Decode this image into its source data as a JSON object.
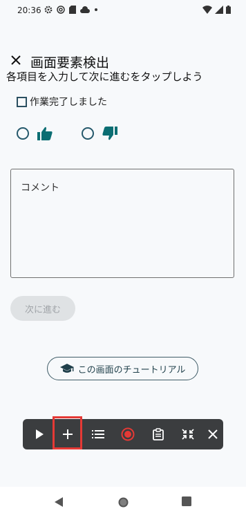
{
  "status_bar": {
    "time": "20:36",
    "left_icons": [
      "gear-icon",
      "at-icon",
      "sd-card-icon",
      "cloud-icon",
      "dot-icon"
    ],
    "right_icons": [
      "wifi-icon",
      "signal-icon",
      "battery-icon"
    ]
  },
  "header": {
    "title": "画面要素検出",
    "instruction": "各項目を入力して次に進むをタップしよう"
  },
  "form": {
    "checkbox_label": "作業完了しました",
    "checkbox_checked": false,
    "comment_placeholder": "コメント",
    "next_label": "次に進む",
    "tutorial_label": "この画面のチュートリアル"
  },
  "toolbar": {
    "buttons": [
      "play-icon",
      "plus-icon",
      "list-icon",
      "record-icon",
      "clipboard-icon",
      "collapse-icon",
      "close-icon"
    ],
    "highlighted": "plus-icon"
  },
  "colors": {
    "accent": "#0b6e73",
    "toolbar_bg": "#3b3d3f",
    "record": "#e53935",
    "highlight": "#e53935"
  }
}
